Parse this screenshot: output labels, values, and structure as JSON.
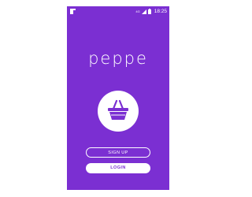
{
  "status_bar": {
    "time": "18:25",
    "network_label": "4G",
    "icons": [
      "app-notification-icon",
      "network-icon",
      "signal-icon",
      "battery-icon"
    ]
  },
  "app": {
    "title": "peppe",
    "logo_icon": "shopping-basket-icon"
  },
  "buttons": {
    "signup_label": "SIGN UP",
    "login_label": "LOGIN"
  },
  "colors": {
    "brand_purple": "#7b2fd2",
    "foreground": "#ffffff"
  }
}
